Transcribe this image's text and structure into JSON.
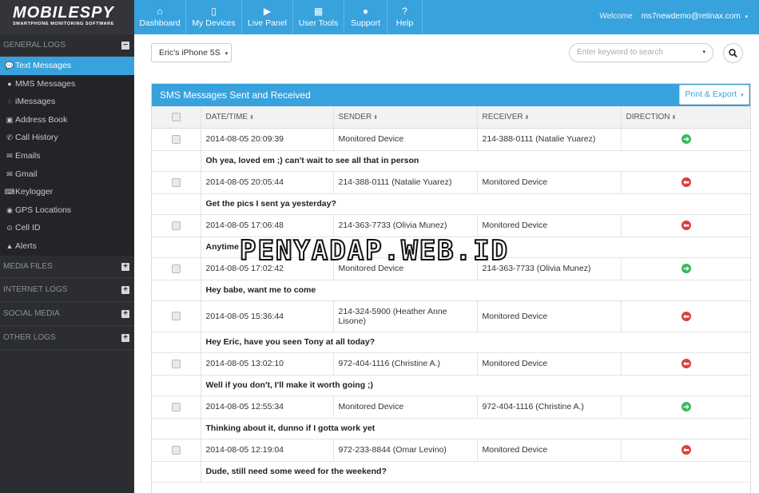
{
  "logo": {
    "main": "MOBILESPY",
    "sub": "SMARTPHONE MONITORING SOFTWARE"
  },
  "sidebar": {
    "general": {
      "label": "GENERAL LOGS",
      "toggle": "−"
    },
    "items": [
      {
        "label": "Text Messages",
        "icon": "chat-icon",
        "glyph": "💬"
      },
      {
        "label": "MMS Messages",
        "icon": "play-circle-icon",
        "glyph": "●"
      },
      {
        "label": "iMessages",
        "icon": "chat-bubble-icon",
        "glyph": "◌"
      },
      {
        "label": "Address Book",
        "icon": "address-book-icon",
        "glyph": "▣"
      },
      {
        "label": "Call History",
        "icon": "phone-icon",
        "glyph": "✆"
      },
      {
        "label": "Emails",
        "icon": "envelope-icon",
        "glyph": "✉"
      },
      {
        "label": "Gmail",
        "icon": "envelope-outline-icon",
        "glyph": "✉"
      },
      {
        "label": "Keylogger",
        "icon": "keyboard-icon",
        "glyph": "⌨"
      },
      {
        "label": "GPS Locations",
        "icon": "map-marker-icon",
        "glyph": "◉"
      },
      {
        "label": "Cell ID",
        "icon": "signal-icon",
        "glyph": "⊙"
      },
      {
        "label": "Alerts",
        "icon": "warning-icon",
        "glyph": "▲"
      }
    ],
    "sections": [
      {
        "label": "MEDIA FILES",
        "toggle": "+"
      },
      {
        "label": "INTERNET LOGS",
        "toggle": "+"
      },
      {
        "label": "SOCIAL MEDIA",
        "toggle": "+"
      },
      {
        "label": "OTHER LOGS",
        "toggle": "+"
      }
    ]
  },
  "nav": [
    {
      "label": "Dashboard",
      "icon": "home-icon",
      "glyph": "⌂"
    },
    {
      "label": "My Devices",
      "icon": "mobile-icon",
      "glyph": "▯"
    },
    {
      "label": "Live Panel",
      "icon": "video-icon",
      "glyph": "▶"
    },
    {
      "label": "User Tools",
      "icon": "briefcase-icon",
      "glyph": "▦"
    },
    {
      "label": "Support",
      "icon": "user-icon",
      "glyph": "●"
    },
    {
      "label": "Help",
      "icon": "question-icon",
      "glyph": "?"
    }
  ],
  "header": {
    "welcome": "Welcome",
    "email": "ms7newdemo@retinax.com",
    "caret": "▾"
  },
  "device": {
    "selected": "Eric's iPhone 5S",
    "caret": "▾"
  },
  "search": {
    "placeholder": "Enter keyword to search"
  },
  "panel": {
    "title": "SMS Messages Sent and Received",
    "export_label": "Print & Export",
    "columns": [
      "DATE/TIME",
      "SENDER",
      "RECEIVER",
      "DIRECTION"
    ],
    "sort_glyph": "⬍"
  },
  "messages": [
    {
      "datetime": "2014-08-05 20:09:39",
      "sender": "Monitored Device",
      "receiver": "214-388-0111 (Natalie Yuarez)",
      "direction": "out",
      "text": "Oh yea, loved em ;) can't wait to see all that in person"
    },
    {
      "datetime": "2014-08-05 20:05:44",
      "sender": "214-388-0111 (Natalie Yuarez)",
      "receiver": "Monitored Device",
      "direction": "in",
      "text": "Get the pics I sent ya yesterday?"
    },
    {
      "datetime": "2014-08-05 17:06:48",
      "sender": "214-363-7733 (Olivia Munez)",
      "receiver": "Monitored Device",
      "direction": "in",
      "text": "Anytime"
    },
    {
      "datetime": "2014-08-05 17:02:42",
      "sender": "Monitored Device",
      "receiver": "214-363-7733 (Olivia Munez)",
      "direction": "out",
      "text": "Hey babe, want me to come"
    },
    {
      "datetime": "2014-08-05 15:36:44",
      "sender": "214-324-5900 (Heather Anne Lisone)",
      "receiver": "Monitored Device",
      "direction": "in",
      "text": "Hey Eric, have you seen Tony at all today?"
    },
    {
      "datetime": "2014-08-05 13:02:10",
      "sender": "972-404-1116 (Christine A.)",
      "receiver": "Monitored Device",
      "direction": "in",
      "text": "Well if you don't, I'll make it worth going ;)"
    },
    {
      "datetime": "2014-08-05 12:55:34",
      "sender": "Monitored Device",
      "receiver": "972-404-1116 (Christine A.)",
      "direction": "out",
      "text": "Thinking about it, dunno if I gotta work yet"
    },
    {
      "datetime": "2014-08-05 12:19:04",
      "sender": "972-233-8844 (Omar Levino)",
      "receiver": "Monitored Device",
      "direction": "in",
      "text": "Dude, still need some weed for the weekend?"
    }
  ],
  "watermark": "PENYADAP.WEB.ID",
  "colors": {
    "accent": "#38a2dd",
    "sidebar": "#2b2d31",
    "out": "#3bb95b",
    "in": "#d9403a"
  }
}
